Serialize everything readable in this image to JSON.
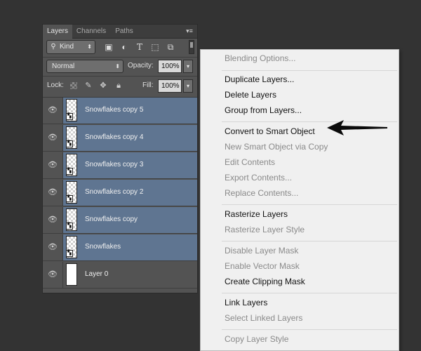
{
  "panel": {
    "tabs": [
      "Layers",
      "Channels",
      "Paths"
    ],
    "active_tab": "Layers",
    "menu_icon": "panel-menu-icon",
    "filter": {
      "kind_label": "Kind",
      "icons": [
        "pixel-filter-icon",
        "adjustment-filter-icon",
        "type-filter-icon",
        "shape-filter-icon",
        "smart-object-filter-icon"
      ]
    },
    "blend_mode": "Normal",
    "opacity_label": "Opacity:",
    "opacity_value": "100%",
    "lock_label": "Lock:",
    "fill_label": "Fill:",
    "fill_value": "100%",
    "layers": [
      {
        "name": "Snowflakes copy 5",
        "selected": true,
        "type": "smart"
      },
      {
        "name": "Snowflakes copy 4",
        "selected": true,
        "type": "smart"
      },
      {
        "name": "Snowflakes copy 3",
        "selected": true,
        "type": "smart"
      },
      {
        "name": "Snowflakes copy 2",
        "selected": true,
        "type": "smart"
      },
      {
        "name": "Snowflakes copy",
        "selected": true,
        "type": "smart"
      },
      {
        "name": "Snowflakes",
        "selected": true,
        "type": "smart"
      },
      {
        "name": "Layer 0",
        "selected": false,
        "type": "white"
      }
    ]
  },
  "context_menu": {
    "items": [
      {
        "label": "Blending Options...",
        "enabled": false
      },
      {
        "label": "Duplicate Layers...",
        "enabled": true
      },
      {
        "label": "Delete Layers",
        "enabled": true
      },
      {
        "label": "Group from Layers...",
        "enabled": true
      },
      {
        "label": "Convert to Smart Object",
        "enabled": true
      },
      {
        "label": "New Smart Object via Copy",
        "enabled": false
      },
      {
        "label": "Edit Contents",
        "enabled": false
      },
      {
        "label": "Export Contents...",
        "enabled": false
      },
      {
        "label": "Replace Contents...",
        "enabled": false
      },
      {
        "label": "Rasterize Layers",
        "enabled": true
      },
      {
        "label": "Rasterize Layer Style",
        "enabled": false
      },
      {
        "label": "Disable Layer Mask",
        "enabled": false
      },
      {
        "label": "Enable Vector Mask",
        "enabled": false
      },
      {
        "label": "Create Clipping Mask",
        "enabled": true
      },
      {
        "label": "Link Layers",
        "enabled": true
      },
      {
        "label": "Select Linked Layers",
        "enabled": false
      },
      {
        "label": "Copy Layer Style",
        "enabled": false
      }
    ]
  },
  "colors": {
    "background": "#333333",
    "panel": "#535353",
    "selected_layer": "#5f7591",
    "menu_bg": "#f0f0f0",
    "menu_disabled_text": "#8a8a8a"
  }
}
